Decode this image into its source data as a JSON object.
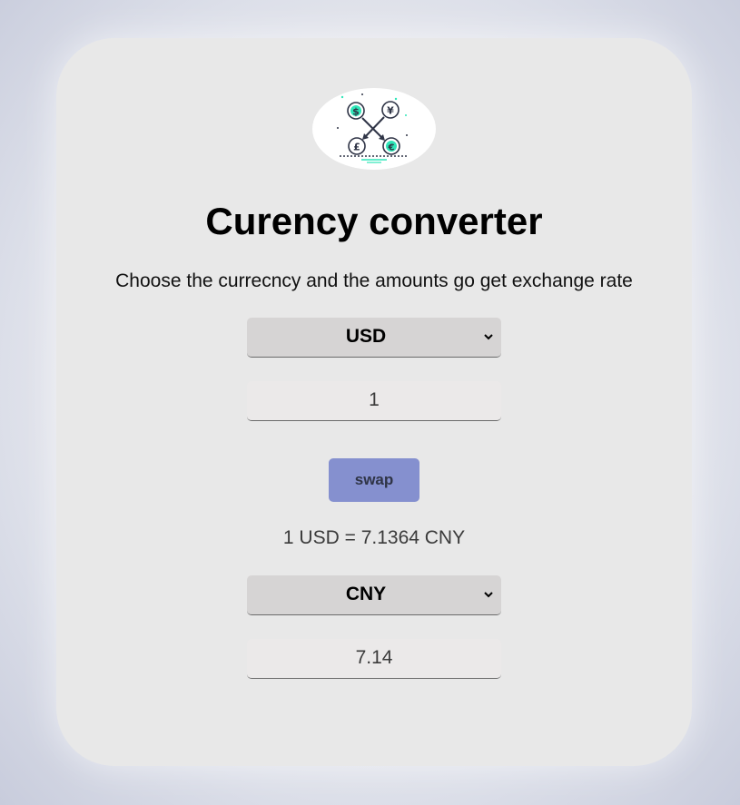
{
  "logo": {
    "icon": "currency-exchange-icon",
    "colors": {
      "accent": "#2ee6b8",
      "stroke": "#2f3446"
    }
  },
  "header": {
    "title": "Curency converter",
    "subtitle": "Choose the currecncy and the amounts go get exchange rate"
  },
  "from": {
    "currency": "USD",
    "amount": "1"
  },
  "swap_label": "swap",
  "rate_text": "1 USD = 7.1364 CNY",
  "to": {
    "currency": "CNY",
    "amount": "7.14"
  },
  "colors": {
    "card": "#e8e8e8",
    "select_bg": "#d6d4d4",
    "swap_button": "#8590cf"
  }
}
